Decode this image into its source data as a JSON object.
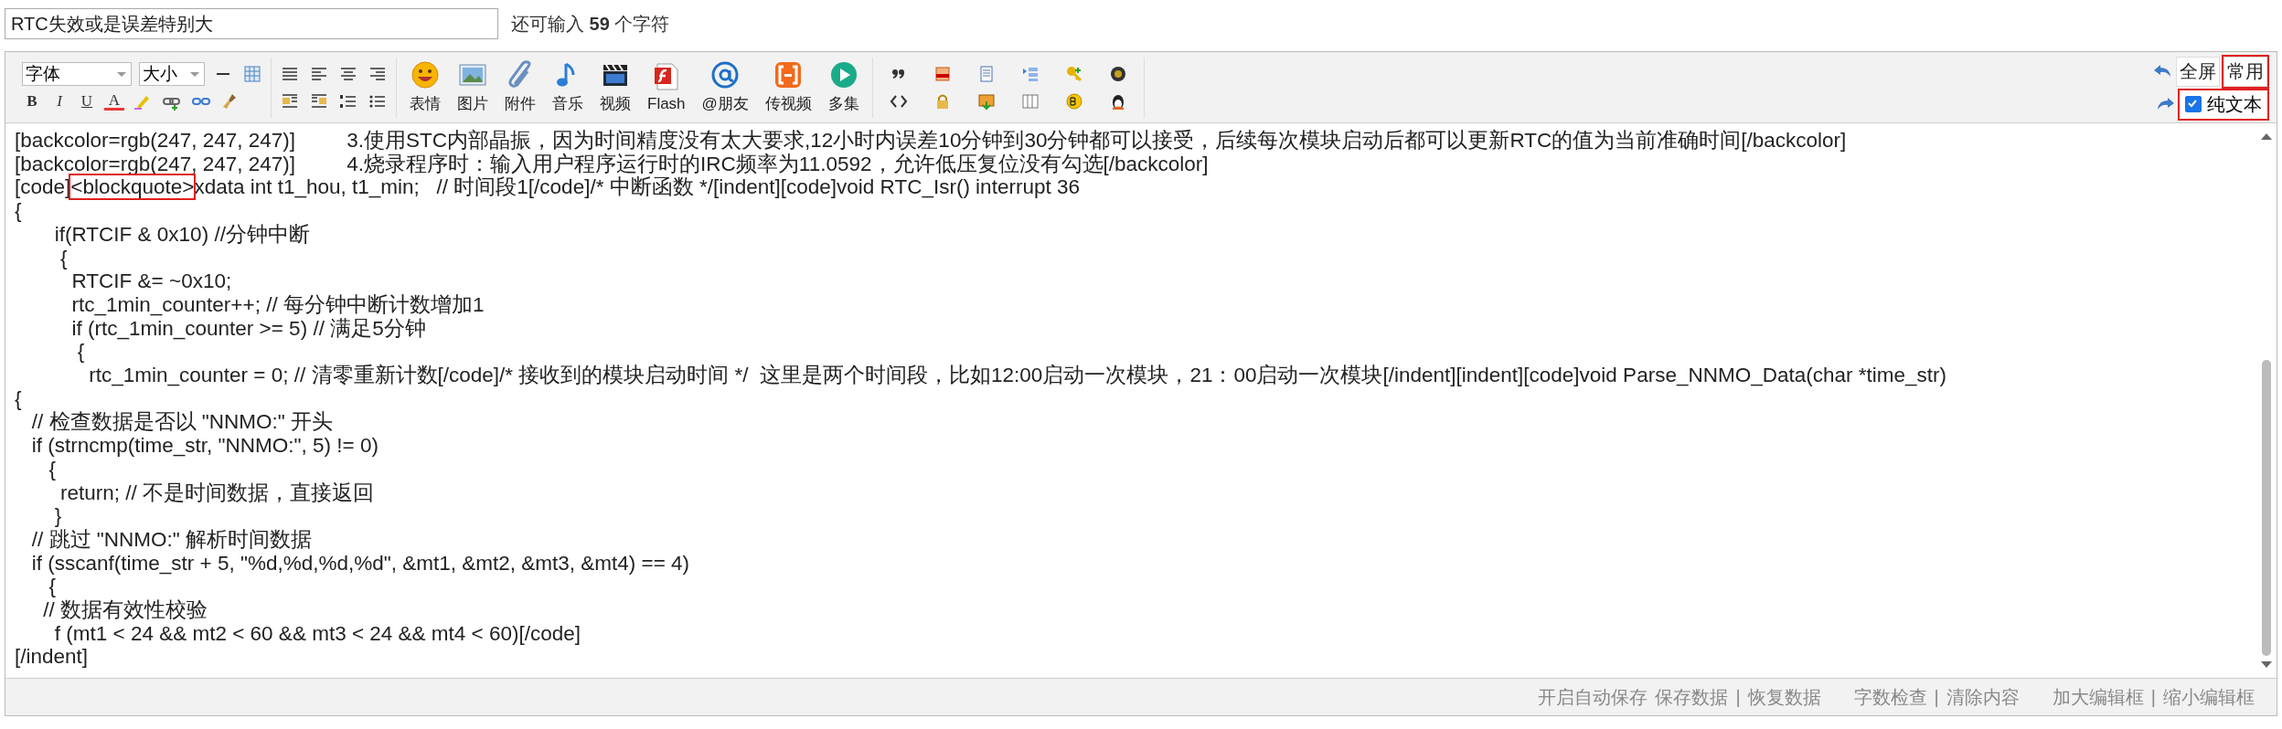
{
  "title_field": {
    "value": "RTC失效或是误差特别大"
  },
  "counter": "还可输入 **59** 个字符",
  "toolbar": {
    "font_select": "字体",
    "size_select": "大小",
    "format_letters": [
      "B",
      "I",
      "U",
      "A"
    ],
    "media_buttons": [
      "表情",
      "图片",
      "附件",
      "音乐",
      "视频",
      "Flash",
      "@朋友",
      "传视频",
      "多集"
    ],
    "right_buttons": [
      {
        "label": "全屏",
        "highlighted": false
      },
      {
        "label": "常用",
        "highlighted": true
      }
    ],
    "plain_text": {
      "label": "纯文本",
      "checked": true,
      "highlighted": true
    }
  },
  "lines": [
    [
      {
        "text": "[backcolor=rgb(247, 247, 247)]         3.使用STC内部晶振，因为时间精度没有太大要求,12小时内误差10分钟到30分钟都可以接受，后续每次模块启动后都可以更新RTC的值为当前准确时间[/backcolor]",
        "highlighted": false
      }
    ],
    [
      {
        "text": "[backcolor=rgb(247, 247, 247)]         4.烧录程序时：输入用户程序运行时的IRC频率为11.0592，允许低压复位没有勾选[/backcolor]",
        "highlighted": false
      }
    ],
    [
      {
        "text": "[code]",
        "highlighted": false
      },
      {
        "text": "<blockquote>",
        "highlighted": true
      },
      {
        "text": "xdata int t1_hou, t1_min;   // 时间段1[/code]/* 中断函数 */[indent][code]void RTC_Isr() interrupt 36",
        "highlighted": false
      }
    ],
    [
      {
        "text": "{",
        "highlighted": false
      }
    ],
    [
      {
        "text": "       if(RTCIF & 0x10) //分钟中断",
        "highlighted": false
      }
    ],
    [
      {
        "text": "        {",
        "highlighted": false
      }
    ],
    [
      {
        "text": "          RTCIF &= ~0x10;",
        "highlighted": false
      }
    ],
    [
      {
        "text": "          rtc_1min_counter++; // 每分钟中断计数增加1",
        "highlighted": false
      }
    ],
    [
      {
        "text": "          if (rtc_1min_counter >= 5) // 满足5分钟",
        "highlighted": false
      }
    ],
    [
      {
        "text": "           {",
        "highlighted": false
      }
    ],
    [
      {
        "text": "             rtc_1min_counter = 0; // 清零重新计数[/code]/* 接收到的模块启动时间 */  这里是两个时间段，比如12:00启动一次模块，21：00启动一次模块[/indent][indent][code]void Parse_NNMO_Data(char *time_str)",
        "highlighted": false
      }
    ],
    [
      {
        "text": "{",
        "highlighted": false
      }
    ],
    [
      {
        "text": "   // 检查数据是否以 \"NNMO:\" 开头",
        "highlighted": false
      }
    ],
    [
      {
        "text": "   if (strncmp(time_str, \"NNMO:\", 5) != 0)",
        "highlighted": false
      }
    ],
    [
      {
        "text": "      {",
        "highlighted": false
      }
    ],
    [
      {
        "text": "        return; // 不是时间数据，直接返回",
        "highlighted": false
      }
    ],
    [
      {
        "text": "       }",
        "highlighted": false
      }
    ],
    [
      {
        "text": "   // 跳过 \"NNMO:\" 解析时间数据",
        "highlighted": false
      }
    ],
    [
      {
        "text": "   if (sscanf(time_str + 5, \"%d,%d,%d,%d\", &mt1, &mt2, &mt3, &mt4) == 4)",
        "highlighted": false
      }
    ],
    [
      {
        "text": "      {",
        "highlighted": false
      }
    ],
    [
      {
        "text": "     // 数据有效性校验",
        "highlighted": false
      }
    ],
    [
      {
        "text": "       f (mt1 < 24 && mt2 < 60 && mt3 < 24 && mt4 < 60)[/code]",
        "highlighted": false
      }
    ],
    [
      {
        "text": "[/indent]",
        "highlighted": false
      }
    ]
  ],
  "footer": [
    {
      "kind": "link",
      "text": "开启自动保存"
    },
    {
      "kind": "link",
      "text": "保存数据"
    },
    {
      "kind": "separator",
      "text": "|"
    },
    {
      "kind": "link",
      "text": "恢复数据"
    },
    {
      "kind": "gap"
    },
    {
      "kind": "link",
      "text": "字数检查"
    },
    {
      "kind": "separator",
      "text": "|"
    },
    {
      "kind": "link",
      "text": "清除内容"
    },
    {
      "kind": "gap"
    },
    {
      "kind": "link",
      "text": "加大编辑框"
    },
    {
      "kind": "separator",
      "text": "|"
    },
    {
      "kind": "link",
      "text": "缩小编辑框"
    }
  ]
}
